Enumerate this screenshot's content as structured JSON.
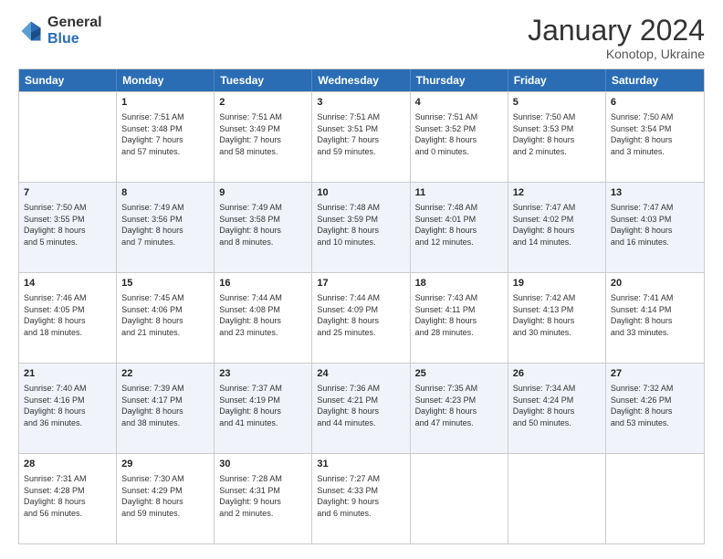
{
  "header": {
    "logo_general": "General",
    "logo_blue": "Blue",
    "month_title": "January 2024",
    "subtitle": "Konotop, Ukraine"
  },
  "weekdays": [
    "Sunday",
    "Monday",
    "Tuesday",
    "Wednesday",
    "Thursday",
    "Friday",
    "Saturday"
  ],
  "rows": [
    {
      "alt": false,
      "cells": [
        {
          "day": "",
          "lines": []
        },
        {
          "day": "1",
          "lines": [
            "Sunrise: 7:51 AM",
            "Sunset: 3:48 PM",
            "Daylight: 7 hours",
            "and 57 minutes."
          ]
        },
        {
          "day": "2",
          "lines": [
            "Sunrise: 7:51 AM",
            "Sunset: 3:49 PM",
            "Daylight: 7 hours",
            "and 58 minutes."
          ]
        },
        {
          "day": "3",
          "lines": [
            "Sunrise: 7:51 AM",
            "Sunset: 3:51 PM",
            "Daylight: 7 hours",
            "and 59 minutes."
          ]
        },
        {
          "day": "4",
          "lines": [
            "Sunrise: 7:51 AM",
            "Sunset: 3:52 PM",
            "Daylight: 8 hours",
            "and 0 minutes."
          ]
        },
        {
          "day": "5",
          "lines": [
            "Sunrise: 7:50 AM",
            "Sunset: 3:53 PM",
            "Daylight: 8 hours",
            "and 2 minutes."
          ]
        },
        {
          "day": "6",
          "lines": [
            "Sunrise: 7:50 AM",
            "Sunset: 3:54 PM",
            "Daylight: 8 hours",
            "and 3 minutes."
          ]
        }
      ]
    },
    {
      "alt": true,
      "cells": [
        {
          "day": "7",
          "lines": [
            "Sunrise: 7:50 AM",
            "Sunset: 3:55 PM",
            "Daylight: 8 hours",
            "and 5 minutes."
          ]
        },
        {
          "day": "8",
          "lines": [
            "Sunrise: 7:49 AM",
            "Sunset: 3:56 PM",
            "Daylight: 8 hours",
            "and 7 minutes."
          ]
        },
        {
          "day": "9",
          "lines": [
            "Sunrise: 7:49 AM",
            "Sunset: 3:58 PM",
            "Daylight: 8 hours",
            "and 8 minutes."
          ]
        },
        {
          "day": "10",
          "lines": [
            "Sunrise: 7:48 AM",
            "Sunset: 3:59 PM",
            "Daylight: 8 hours",
            "and 10 minutes."
          ]
        },
        {
          "day": "11",
          "lines": [
            "Sunrise: 7:48 AM",
            "Sunset: 4:01 PM",
            "Daylight: 8 hours",
            "and 12 minutes."
          ]
        },
        {
          "day": "12",
          "lines": [
            "Sunrise: 7:47 AM",
            "Sunset: 4:02 PM",
            "Daylight: 8 hours",
            "and 14 minutes."
          ]
        },
        {
          "day": "13",
          "lines": [
            "Sunrise: 7:47 AM",
            "Sunset: 4:03 PM",
            "Daylight: 8 hours",
            "and 16 minutes."
          ]
        }
      ]
    },
    {
      "alt": false,
      "cells": [
        {
          "day": "14",
          "lines": [
            "Sunrise: 7:46 AM",
            "Sunset: 4:05 PM",
            "Daylight: 8 hours",
            "and 18 minutes."
          ]
        },
        {
          "day": "15",
          "lines": [
            "Sunrise: 7:45 AM",
            "Sunset: 4:06 PM",
            "Daylight: 8 hours",
            "and 21 minutes."
          ]
        },
        {
          "day": "16",
          "lines": [
            "Sunrise: 7:44 AM",
            "Sunset: 4:08 PM",
            "Daylight: 8 hours",
            "and 23 minutes."
          ]
        },
        {
          "day": "17",
          "lines": [
            "Sunrise: 7:44 AM",
            "Sunset: 4:09 PM",
            "Daylight: 8 hours",
            "and 25 minutes."
          ]
        },
        {
          "day": "18",
          "lines": [
            "Sunrise: 7:43 AM",
            "Sunset: 4:11 PM",
            "Daylight: 8 hours",
            "and 28 minutes."
          ]
        },
        {
          "day": "19",
          "lines": [
            "Sunrise: 7:42 AM",
            "Sunset: 4:13 PM",
            "Daylight: 8 hours",
            "and 30 minutes."
          ]
        },
        {
          "day": "20",
          "lines": [
            "Sunrise: 7:41 AM",
            "Sunset: 4:14 PM",
            "Daylight: 8 hours",
            "and 33 minutes."
          ]
        }
      ]
    },
    {
      "alt": true,
      "cells": [
        {
          "day": "21",
          "lines": [
            "Sunrise: 7:40 AM",
            "Sunset: 4:16 PM",
            "Daylight: 8 hours",
            "and 36 minutes."
          ]
        },
        {
          "day": "22",
          "lines": [
            "Sunrise: 7:39 AM",
            "Sunset: 4:17 PM",
            "Daylight: 8 hours",
            "and 38 minutes."
          ]
        },
        {
          "day": "23",
          "lines": [
            "Sunrise: 7:37 AM",
            "Sunset: 4:19 PM",
            "Daylight: 8 hours",
            "and 41 minutes."
          ]
        },
        {
          "day": "24",
          "lines": [
            "Sunrise: 7:36 AM",
            "Sunset: 4:21 PM",
            "Daylight: 8 hours",
            "and 44 minutes."
          ]
        },
        {
          "day": "25",
          "lines": [
            "Sunrise: 7:35 AM",
            "Sunset: 4:23 PM",
            "Daylight: 8 hours",
            "and 47 minutes."
          ]
        },
        {
          "day": "26",
          "lines": [
            "Sunrise: 7:34 AM",
            "Sunset: 4:24 PM",
            "Daylight: 8 hours",
            "and 50 minutes."
          ]
        },
        {
          "day": "27",
          "lines": [
            "Sunrise: 7:32 AM",
            "Sunset: 4:26 PM",
            "Daylight: 8 hours",
            "and 53 minutes."
          ]
        }
      ]
    },
    {
      "alt": false,
      "cells": [
        {
          "day": "28",
          "lines": [
            "Sunrise: 7:31 AM",
            "Sunset: 4:28 PM",
            "Daylight: 8 hours",
            "and 56 minutes."
          ]
        },
        {
          "day": "29",
          "lines": [
            "Sunrise: 7:30 AM",
            "Sunset: 4:29 PM",
            "Daylight: 8 hours",
            "and 59 minutes."
          ]
        },
        {
          "day": "30",
          "lines": [
            "Sunrise: 7:28 AM",
            "Sunset: 4:31 PM",
            "Daylight: 9 hours",
            "and 2 minutes."
          ]
        },
        {
          "day": "31",
          "lines": [
            "Sunrise: 7:27 AM",
            "Sunset: 4:33 PM",
            "Daylight: 9 hours",
            "and 6 minutes."
          ]
        },
        {
          "day": "",
          "lines": []
        },
        {
          "day": "",
          "lines": []
        },
        {
          "day": "",
          "lines": []
        }
      ]
    }
  ]
}
